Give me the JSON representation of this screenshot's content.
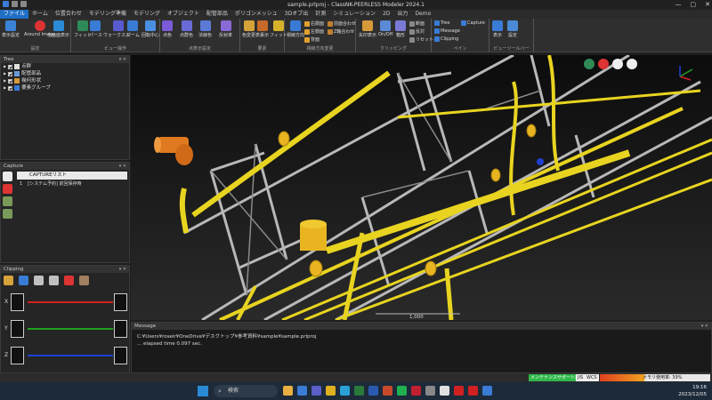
{
  "window": {
    "title": "sample.prlproj - ClassNK-PEERLESS Modeler 2024.1",
    "controls": [
      "—",
      "▢",
      "✕"
    ]
  },
  "tabs": [
    "ファイル",
    "ホーム",
    "位置合わせ",
    "モデリング準備",
    "モデリング",
    "オブジェクト",
    "配管部品",
    "ポリゴンメッシュ",
    "3Dオブ出",
    "計測",
    "シミュレーション",
    "2D",
    "出力",
    "Demo"
  ],
  "ribbon": {
    "groups": {
      "settings": "設定",
      "view_ops": "ビュー操作",
      "point_settings": "点表示設定",
      "elements": "要素",
      "view_direction": "視線方向変更",
      "clipping": "クリッピング",
      "pane": "ペイン",
      "viewtool": "ビューツールバー"
    },
    "buttons": {
      "show_settings": "表示設定",
      "around_image": "Around Image",
      "show_all": "全画面表示",
      "fit": "フィット",
      "pan": "パース",
      "walk": "ウォークスルー",
      "zoom": "ズーム",
      "rotate_center": "回転中心",
      "point_color": "点色",
      "point_group": "点群色",
      "normal_color": "法線色",
      "reflect_color": "反射率",
      "color_change": "色変更",
      "surface_display": "表裏示",
      "element_fit": "フィット",
      "view_direction": "視線方向",
      "right_side": "右側面",
      "left_side": "左側面",
      "back": "背面",
      "front": "前面合わせ",
      "z_align": "Z軸合わせ",
      "arrow_display": "矢印表示",
      "onoff": "On/Off",
      "shape": "箱形",
      "cross_section": "断面",
      "cross_reverse": "反対",
      "reset": "リセット",
      "tree": "Tree",
      "message": "Message",
      "clipping": "Clipping",
      "capture": "Capture",
      "view_show": "表示",
      "view_settings": "設定"
    }
  },
  "tree_panel": {
    "title": "Tree",
    "items": [
      "点群",
      "配管部品",
      "幾何形状",
      "要素グループ"
    ]
  },
  "capture_panel": {
    "title": "Capture",
    "list_header": "CAPTUREリスト",
    "rows": [
      {
        "index": "1",
        "label": "[システム予約] 前回保存時"
      }
    ]
  },
  "clipping_panel": {
    "title": "Clipping",
    "axes": [
      {
        "name": "X",
        "color": "#d42020"
      },
      {
        "name": "Y",
        "color": "#20a020"
      },
      {
        "name": "Z",
        "color": "#2040d0"
      }
    ]
  },
  "viewport": {
    "scale_label": "1,000"
  },
  "message_panel": {
    "title": "Message",
    "lines": [
      "C:¥Users¥roseir¥OneDrive¥デスクトップ¥参考資料¥sample¥sample.prlproj",
      "... elapsed time 0.097 sec."
    ]
  },
  "status_bar": {
    "maintenance": "メンテナンスサポート対象",
    "jis": "JIS",
    "wcs": "WCS",
    "memory": "メモリ使用率: 39%"
  },
  "taskbar": {
    "search_placeholder": "検索",
    "time": "19:16",
    "date": "2023/12/05"
  },
  "colors": {
    "accent": "#1f6fc5",
    "pipe_yellow": "#e8d420",
    "pipe_orange": "#e07a20",
    "steel": "#b8b8b8"
  }
}
